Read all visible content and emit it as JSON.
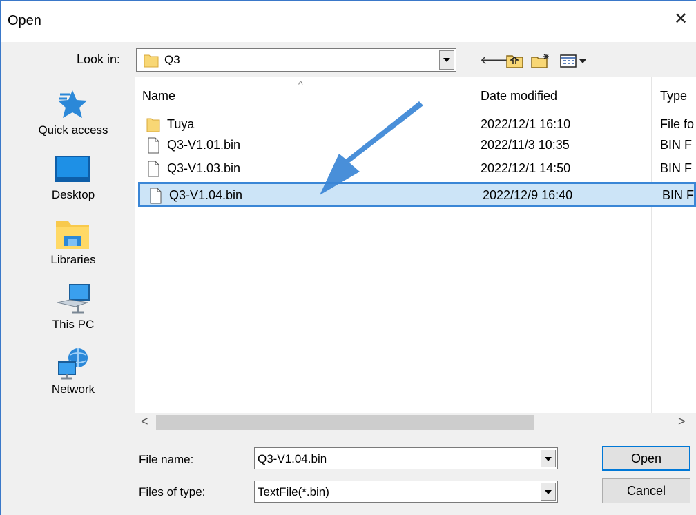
{
  "window": {
    "title": "Open",
    "close_glyph": "✕"
  },
  "lookin": {
    "label": "Look in:",
    "value": "Q3"
  },
  "toolbar": {
    "back_glyph": "🡐",
    "up_icon": "folder-up-icon",
    "new_folder_icon": "new-folder-icon",
    "view_menu_icon": "view-menu-icon"
  },
  "places": [
    {
      "label": "Quick access",
      "icon": "star-icon"
    },
    {
      "label": "Desktop",
      "icon": "desktop-icon"
    },
    {
      "label": "Libraries",
      "icon": "libraries-icon"
    },
    {
      "label": "This PC",
      "icon": "computer-icon"
    },
    {
      "label": "Network",
      "icon": "network-icon"
    }
  ],
  "columns": {
    "name": "Name",
    "date": "Date modified",
    "type": "Type"
  },
  "files": [
    {
      "name": "Tuya",
      "date": "2022/12/1 16:10",
      "type": "File fo",
      "kind": "folder"
    },
    {
      "name": "Q3-V1.01.bin",
      "date": "2022/11/3 10:35",
      "type": "BIN F",
      "kind": "file"
    },
    {
      "name": "Q3-V1.03.bin",
      "date": "2022/12/1 14:50",
      "type": "BIN F",
      "kind": "file"
    },
    {
      "name": "Q3-V1.04.bin",
      "date": "2022/12/9 16:40",
      "type": "BIN F",
      "kind": "file",
      "selected": true
    }
  ],
  "filename": {
    "label": "File name:",
    "value": "Q3-V1.04.bin"
  },
  "filetype": {
    "label": "Files of type:",
    "value": "TextFile(*.bin)"
  },
  "buttons": {
    "open": "Open",
    "cancel": "Cancel"
  },
  "colors": {
    "accent": "#0078d7",
    "selection": "#cce4f7",
    "annotation_arrow": "#3a86d6"
  }
}
